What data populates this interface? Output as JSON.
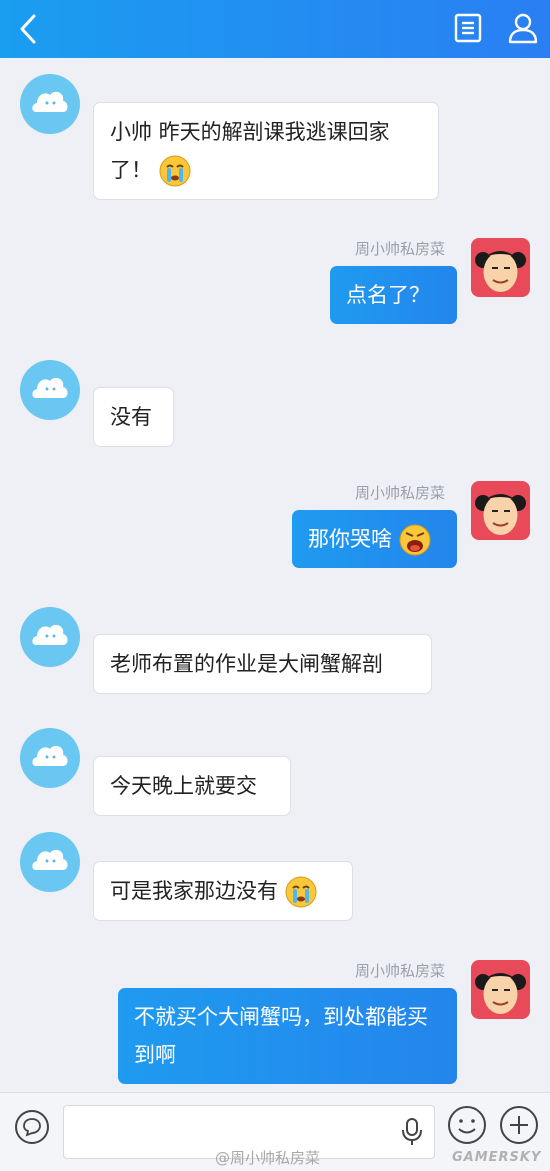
{
  "header": {
    "back_icon": "chevron-left-icon",
    "notes_icon": "document-list-icon",
    "profile_icon": "person-icon",
    "bar_color": "#1f8ff2"
  },
  "messages": [
    {
      "side": "left",
      "text": "小帅 昨天的解剖课我逃课回家了！",
      "emoji": "crying-emoji"
    },
    {
      "side": "right",
      "sender": "周小帅私房菜",
      "text": "点名了？"
    },
    {
      "side": "left",
      "text": "没有"
    },
    {
      "side": "right",
      "sender": "周小帅私房菜",
      "text": "那你哭啥",
      "emoji": "shouting-emoji"
    },
    {
      "side": "left",
      "text": "老师布置的作业是大闸蟹解剖"
    },
    {
      "side": "left",
      "text": "今天晚上就要交"
    },
    {
      "side": "left",
      "text": "可是我家那边没有",
      "emoji": "crying-emoji"
    },
    {
      "side": "right",
      "sender": "周小帅私房菜",
      "text": "不就买个大闸蟹吗，到处都能买到啊"
    }
  ],
  "input_bar": {
    "chat_icon": "speech-bubble-icon",
    "mic_icon": "microphone-icon",
    "emoji_icon": "smiley-icon",
    "plus_icon": "plus-icon"
  },
  "watermarks": {
    "weibo": "@周小帅私房菜",
    "site": "GAMERSKY"
  }
}
